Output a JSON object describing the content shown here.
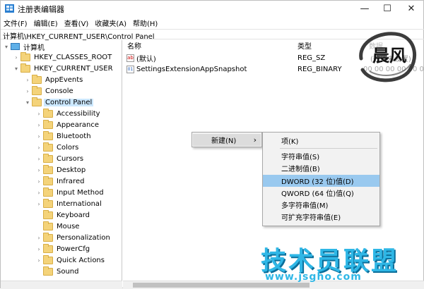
{
  "window": {
    "title": "注册表编辑器",
    "min": "—",
    "max": "☐",
    "close": "✕"
  },
  "menu": [
    "文件(F)",
    "编辑(E)",
    "查看(V)",
    "收藏夹(A)",
    "帮助(H)"
  ],
  "address": "计算机\\HKEY_CURRENT_USER\\Control Panel",
  "tree": {
    "root": "计算机",
    "items": [
      {
        "label": "HKEY_CLASSES_ROOT"
      },
      {
        "label": "HKEY_CURRENT_USER"
      },
      {
        "label": "AppEvents"
      },
      {
        "label": "Console"
      },
      {
        "label": "Control Panel"
      },
      {
        "label": "Accessibility"
      },
      {
        "label": "Appearance"
      },
      {
        "label": "Bluetooth"
      },
      {
        "label": "Colors"
      },
      {
        "label": "Cursors"
      },
      {
        "label": "Desktop"
      },
      {
        "label": "Infrared"
      },
      {
        "label": "Input Method"
      },
      {
        "label": "International"
      },
      {
        "label": "Keyboard"
      },
      {
        "label": "Mouse"
      },
      {
        "label": "Personalization"
      },
      {
        "label": "PowerCfg"
      },
      {
        "label": "Quick Actions"
      },
      {
        "label": "Sound"
      }
    ]
  },
  "list": {
    "headers": {
      "name": "名称",
      "type": "类型",
      "data": "数据"
    },
    "rows": [
      {
        "name": "(默认)",
        "type": "REG_SZ",
        "data": "(数值未设置)"
      },
      {
        "name": "SettingsExtensionAppSnapshot",
        "type": "REG_BINARY",
        "data": "00 00 00 00 00 00"
      }
    ]
  },
  "context_menu": {
    "new_label": "新建(N)",
    "arrow": "›",
    "submenu": [
      "项(K)",
      "字符串值(S)",
      "二进制值(B)",
      "DWORD (32 位)值(D)",
      "QWORD (64 位)值(Q)",
      "多字符串值(M)",
      "可扩充字符串值(E)"
    ],
    "highlighted_index": 3
  },
  "watermark": {
    "brand": "技术员联盟",
    "url": "www.jsgho.com",
    "seal": "晨风"
  },
  "colors": {
    "selection": "#cce8ff",
    "menu_highlight": "#99c9ef",
    "watermark": "#2fb7e6"
  }
}
